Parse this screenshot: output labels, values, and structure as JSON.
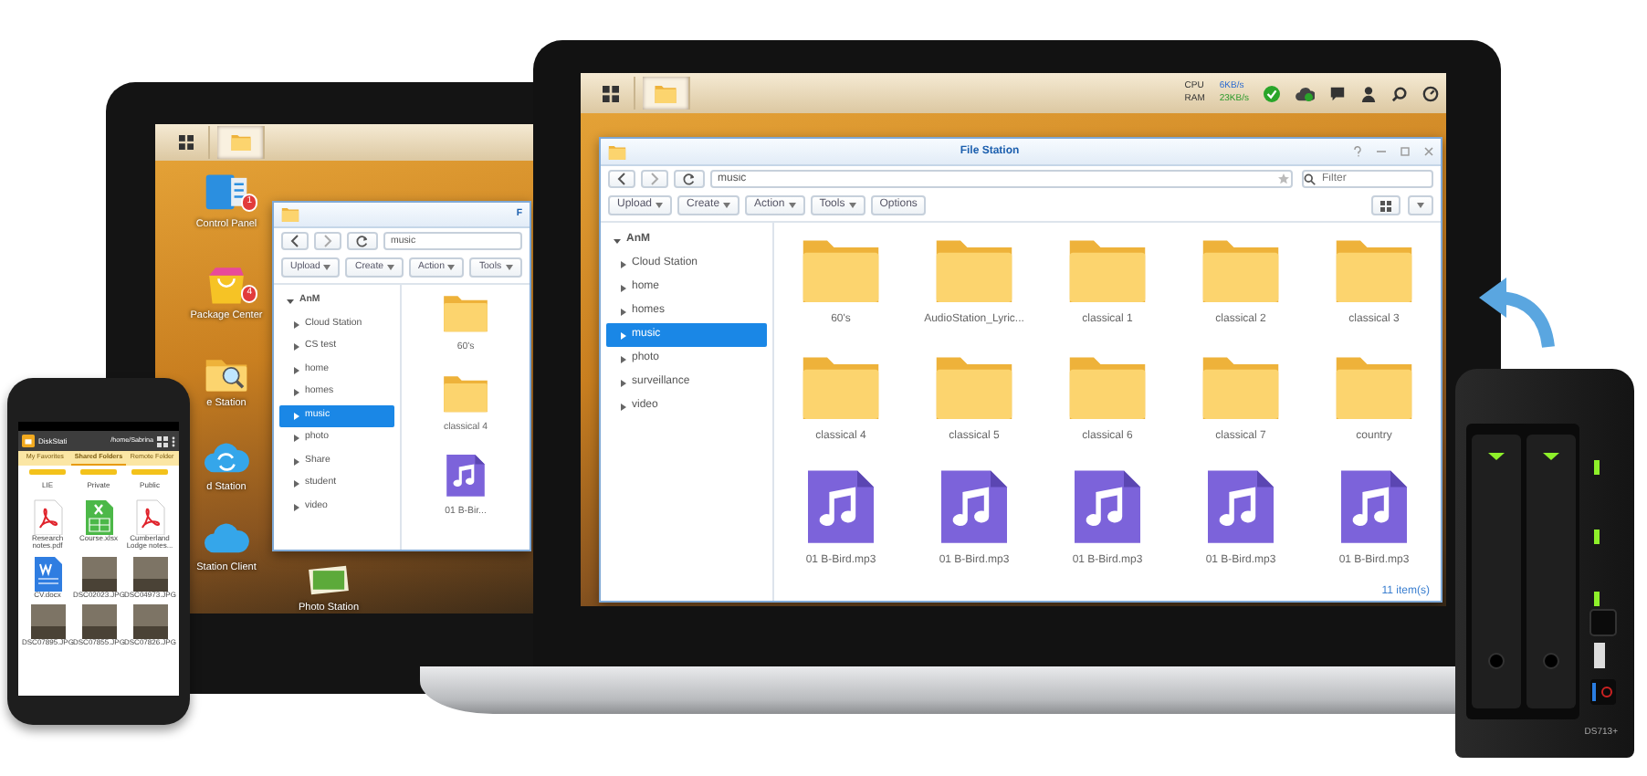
{
  "tablet": {
    "desktop_icons": [
      {
        "kind": "control-panel",
        "label": "Control Panel",
        "badge": "1"
      },
      {
        "kind": "package",
        "label": "Package Center",
        "badge": "4"
      },
      {
        "kind": "file-station",
        "label": "e Station"
      },
      {
        "kind": "cloud-sync",
        "label": "d Station"
      },
      {
        "kind": "cloud",
        "label": "Station Client"
      },
      {
        "kind": "photo",
        "label": "Photo Station"
      }
    ],
    "window": {
      "title": "F",
      "path": "music",
      "toolbar": [
        {
          "label": "Upload",
          "dropdown": true
        },
        {
          "label": "Create",
          "dropdown": true
        },
        {
          "label": "Action",
          "dropdown": true
        },
        {
          "label": "Tools",
          "dropdown": true
        }
      ],
      "tree": {
        "label": "AnM",
        "expanded": true,
        "children": [
          {
            "label": "Cloud Station",
            "selected": false
          },
          {
            "label": "CS test",
            "selected": false
          },
          {
            "label": "home",
            "selected": false
          },
          {
            "label": "homes",
            "selected": false
          },
          {
            "label": "music",
            "selected": true
          },
          {
            "label": "photo",
            "selected": false
          },
          {
            "label": "Share",
            "selected": false
          },
          {
            "label": "student",
            "selected": false
          },
          {
            "label": "video",
            "selected": false
          }
        ]
      },
      "files": [
        {
          "name": "60's",
          "kind": "folder"
        },
        {
          "name": "classical 4",
          "kind": "folder"
        },
        {
          "name": "01 B-Bir...",
          "kind": "audio"
        }
      ]
    }
  },
  "laptop": {
    "taskbar": {
      "meters": [
        "CPU",
        "RAM"
      ],
      "rates": [
        "6KB/s",
        "23KB/s"
      ]
    },
    "window": {
      "title": "File Station",
      "path": "music",
      "filter_placeholder": "Filter",
      "view_menu": true,
      "toolbar": [
        {
          "label": "Upload",
          "dropdown": true
        },
        {
          "label": "Create",
          "dropdown": true
        },
        {
          "label": "Action",
          "dropdown": true
        },
        {
          "label": "Tools",
          "dropdown": true
        },
        {
          "label": "Options",
          "dropdown": false
        }
      ],
      "tree": {
        "label": "AnM",
        "expanded": true,
        "children": [
          {
            "label": "Cloud Station",
            "selected": false
          },
          {
            "label": "home",
            "selected": false
          },
          {
            "label": "homes",
            "selected": false
          },
          {
            "label": "music",
            "selected": true
          },
          {
            "label": "photo",
            "selected": false
          },
          {
            "label": "surveillance",
            "selected": false
          },
          {
            "label": "video",
            "selected": false
          }
        ]
      },
      "files": [
        {
          "name": "60's",
          "kind": "folder"
        },
        {
          "name": "AudioStation_Lyric...",
          "kind": "folder"
        },
        {
          "name": "classical 1",
          "kind": "folder"
        },
        {
          "name": "classical 2",
          "kind": "folder"
        },
        {
          "name": "classical 3",
          "kind": "folder"
        },
        {
          "name": "classical 4",
          "kind": "folder"
        },
        {
          "name": "classical 5",
          "kind": "folder"
        },
        {
          "name": "classical 6",
          "kind": "folder"
        },
        {
          "name": "classical 7",
          "kind": "folder"
        },
        {
          "name": "country",
          "kind": "folder"
        },
        {
          "name": "01 B-Bird.mp3",
          "kind": "audio"
        },
        {
          "name": "01 B-Bird.mp3",
          "kind": "audio"
        },
        {
          "name": "01 B-Bird.mp3",
          "kind": "audio"
        },
        {
          "name": "01 B-Bird.mp3",
          "kind": "audio"
        },
        {
          "name": "01 B-Bird.mp3",
          "kind": "audio"
        }
      ],
      "status": "11 item(s)"
    }
  },
  "phone": {
    "app_title": "DiskStati",
    "path": "/home/Sabrina",
    "tabs": [
      {
        "label": "My Favorites",
        "selected": false
      },
      {
        "label": "Shared Folders",
        "selected": true
      },
      {
        "label": "Remote Folder",
        "selected": false
      }
    ],
    "folders": [
      "LIE",
      "Private",
      "Public"
    ],
    "files": [
      {
        "name": "Research notes.pdf",
        "kind": "pdf"
      },
      {
        "name": "Course.xlsx",
        "kind": "sheet"
      },
      {
        "name": "Cumberland Lodge notes...",
        "kind": "pdf"
      },
      {
        "name": "CV.docx",
        "kind": "doc"
      },
      {
        "name": "DSC02023.JPG",
        "kind": "photo"
      },
      {
        "name": "DSC04973.JPG",
        "kind": "photo"
      },
      {
        "name": "DSC07895.JPG",
        "kind": "photo"
      },
      {
        "name": "DSC07855.JPG",
        "kind": "photo"
      },
      {
        "name": "DSC07826.JPG",
        "kind": "photo"
      }
    ]
  },
  "nas": {
    "model": "DS713+"
  }
}
